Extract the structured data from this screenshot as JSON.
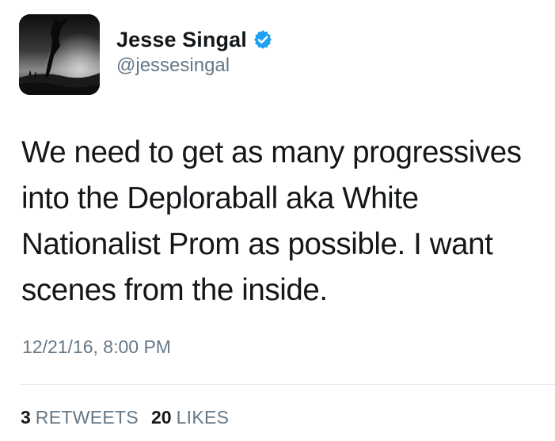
{
  "user": {
    "display_name": "Jesse Singal",
    "handle": "@jessesingal",
    "verified": true
  },
  "tweet": {
    "text": "We need to get as many progressives into the Deploraball aka White Nationalist Prom as possible. I want scenes from the inside.",
    "timestamp": "12/21/16, 8:00 PM"
  },
  "stats": {
    "retweets": {
      "count": "3",
      "label": "RETWEETS"
    },
    "likes": {
      "count": "20",
      "label": "LIKES"
    }
  },
  "colors": {
    "text_primary": "#14171a",
    "text_secondary": "#657786",
    "verified_blue": "#1da1f2",
    "divider": "#e1e8ed"
  },
  "icons": {
    "verified": "verified-badge-icon"
  }
}
